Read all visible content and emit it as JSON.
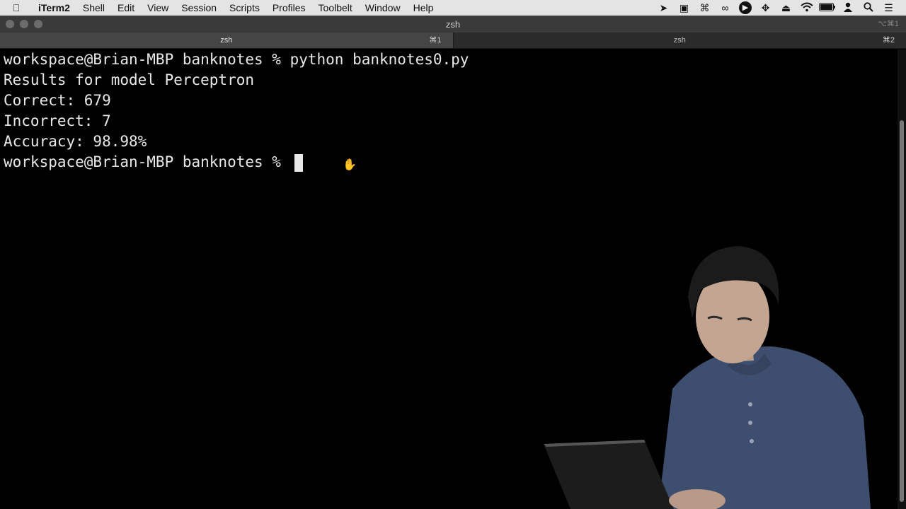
{
  "menubar": {
    "items": [
      "iTerm2",
      "Shell",
      "Edit",
      "View",
      "Session",
      "Scripts",
      "Profiles",
      "Toolbelt",
      "Window",
      "Help"
    ],
    "status_icons": [
      "location-icon",
      "docker-icon",
      "command-icon",
      "glasses-icon",
      "play-icon",
      "move-icon",
      "eject-icon",
      "wifi-icon",
      "battery-icon",
      "user-icon",
      "search-icon",
      "list-icon"
    ]
  },
  "window": {
    "title": "zsh",
    "shortcut": "⌥⌘1"
  },
  "tabs": [
    {
      "label": "zsh",
      "shortcut": "⌘1",
      "active": true
    },
    {
      "label": "zsh",
      "shortcut": "⌘2",
      "active": false
    }
  ],
  "terminal": {
    "lines": [
      "workspace@Brian-MBP banknotes % python banknotes0.py",
      "Results for model Perceptron",
      "Correct: 679",
      "Incorrect: 7",
      "Accuracy: 98.98%",
      "workspace@Brian-MBP banknotes % "
    ]
  },
  "colors": {
    "menubar_bg": "#e4e4e4",
    "terminal_bg": "#000000",
    "terminal_fg": "#e8e8e8"
  }
}
